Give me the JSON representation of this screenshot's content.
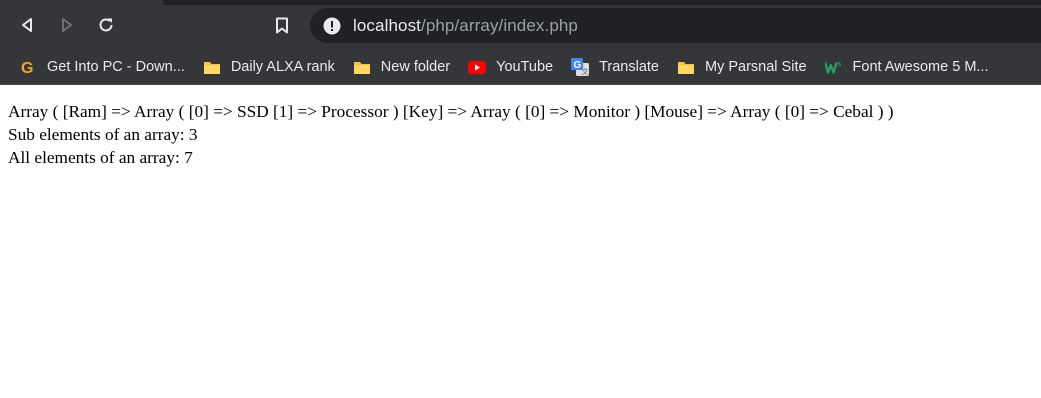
{
  "browser": {
    "url_host": "localhost",
    "url_path": "/php/array/index.php"
  },
  "bookmarks": [
    {
      "label": "Get Into PC - Down...",
      "icon": "g-logo-icon"
    },
    {
      "label": "Daily ALXA rank",
      "icon": "folder-icon"
    },
    {
      "label": "New folder",
      "icon": "folder-icon"
    },
    {
      "label": "YouTube",
      "icon": "youtube-icon"
    },
    {
      "label": "Translate",
      "icon": "google-translate-icon"
    },
    {
      "label": "My Parsnal Site",
      "icon": "folder-icon"
    },
    {
      "label": "Font Awesome 5 M...",
      "icon": "w-logo-icon"
    }
  ],
  "page": {
    "line1": "Array ( [Ram] => Array ( [0] => SSD [1] => Processor ) [Key] => Array ( [0] => Monitor ) [Mouse] => Array ( [0] => Cebal ) )",
    "line2": "Sub elements of an array: 3",
    "line3": "All elements of an array: 7"
  },
  "colors": {
    "chrome_bg": "#35363a",
    "omnibox_bg": "#202124",
    "icon_gray": "#e8eaed",
    "folder_yellow": "#f5c342",
    "youtube_red": "#ff0000"
  }
}
